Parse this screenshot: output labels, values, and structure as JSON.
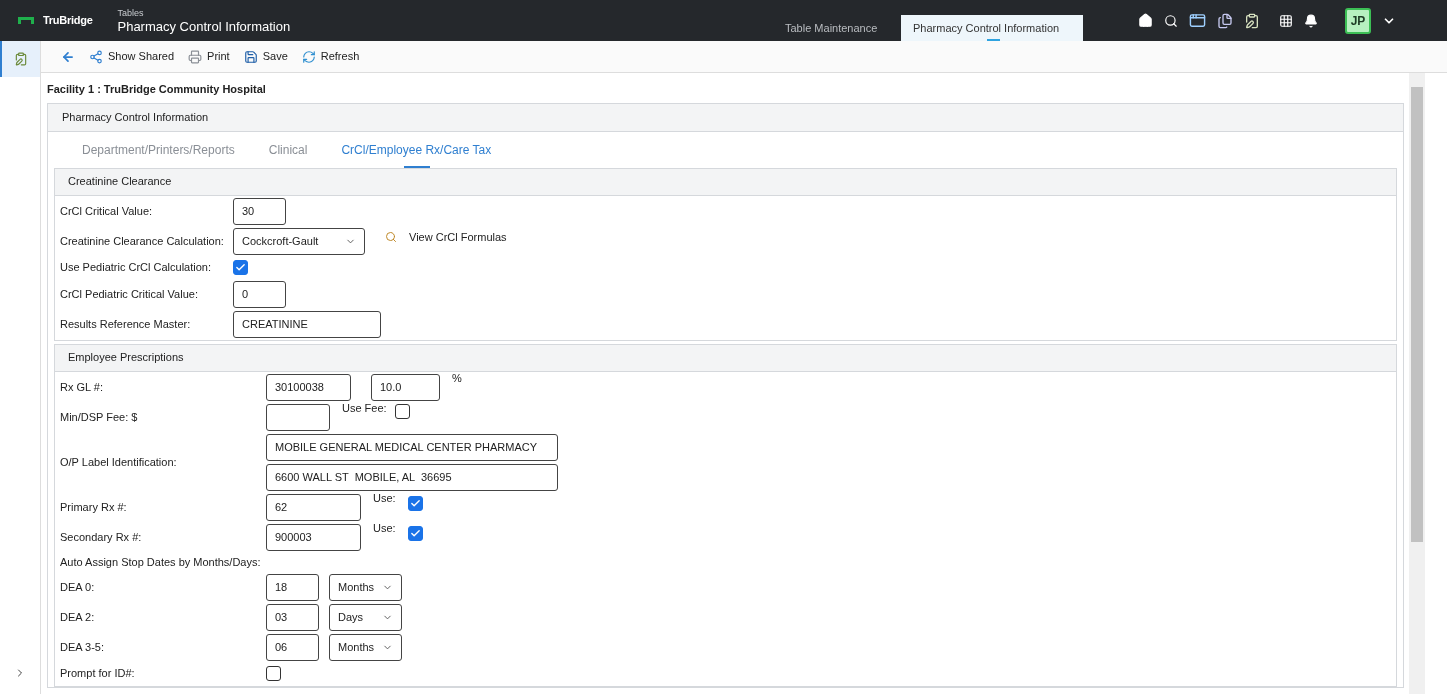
{
  "header": {
    "logo": "TruBridge",
    "breadcrumb": "Tables",
    "title": "Pharmacy Control Information"
  },
  "tabs": [
    {
      "label": "Table Maintenance",
      "selected": false
    },
    {
      "label": "Pharmacy Control Information",
      "selected": true
    }
  ],
  "avatar": "JP",
  "toolbar": [
    {
      "kind": "back"
    },
    {
      "kind": "shared",
      "label": "Show Shared"
    },
    {
      "kind": "print",
      "label": "Print"
    },
    {
      "kind": "save",
      "label": "Save"
    },
    {
      "kind": "refresh",
      "label": "Refresh"
    }
  ],
  "facility_title": "Facility 1 : TruBridge Community Hospital",
  "panel": {
    "title": "Pharmacy Control Information",
    "tabs": [
      {
        "label": "Department/Printers/Reports",
        "selected": false
      },
      {
        "label": "Clinical",
        "selected": false
      },
      {
        "label": "CrCl/Employee Rx/Care Tax",
        "selected": true
      }
    ],
    "sections": [
      {
        "title": "Creatinine Clearance",
        "rows": [
          {
            "kind": "short_field",
            "label": "CrCl Critical Value:",
            "value": "30"
          },
          {
            "kind": "select",
            "label": "Creatinine Clearance Calculation:",
            "value": "Cockcroft-Gault",
            "link": "View CrCl Formulas"
          },
          {
            "kind": "checkbox",
            "label": "Use Pediatric CrCl Calculation:",
            "checked": true
          },
          {
            "kind": "short_field",
            "label": "CrCl Pediatric Critical Value:",
            "value": "0"
          },
          {
            "kind": "long_field",
            "label": "Results Reference Master:",
            "value": "CREATININE"
          }
        ]
      },
      {
        "title": "Employee Prescriptions",
        "rows": [
          {
            "kind": "gl",
            "label": "Rx GL #:",
            "values": [
              "30100038",
              "10.0"
            ],
            "suffix": "%"
          },
          {
            "kind": "fee",
            "label": "Min/DSP Fee: $",
            "use_label": "Use Fee:",
            "checked": false
          },
          {
            "kind": "lines",
            "label": "O/P Label Identification:",
            "values": [
              "MOBILE GENERAL MEDICAL CENTER PHARMACY",
              "6600 WALL ST  MOBILE, AL  36695"
            ]
          },
          {
            "kind": "rx",
            "label": "Primary Rx #:",
            "value": "62",
            "use_label": "Use:",
            "checked": true
          },
          {
            "kind": "rx",
            "label": "Secondary Rx #:",
            "value": "900003",
            "use_label": "Use:",
            "checked": true
          },
          {
            "kind": "heading",
            "label": "Auto Assign Stop Dates by Months/Days:"
          },
          {
            "kind": "stop",
            "label": "DEA 0:",
            "value": "18",
            "unit": "Months"
          },
          {
            "kind": "stop",
            "label": "DEA 2:",
            "value": "03",
            "unit": "Days"
          },
          {
            "kind": "stop",
            "label": "DEA 3-5:",
            "value": "06",
            "unit": "Months"
          },
          {
            "kind": "checkbox",
            "label": "Prompt for ID#:",
            "checked": false
          }
        ]
      }
    ]
  }
}
